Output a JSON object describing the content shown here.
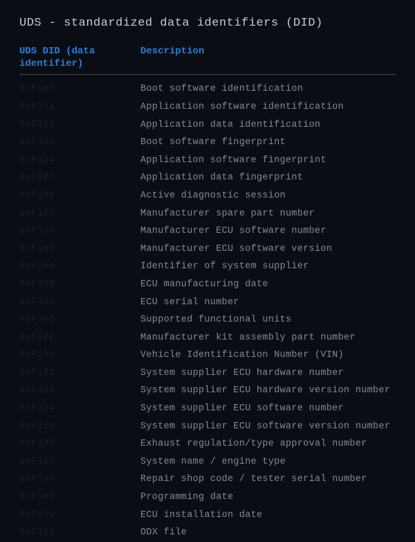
{
  "title": "UDS - standardized data identifiers (DID)",
  "table": {
    "headers": {
      "did": "UDS DID (data identifier)",
      "description": "Description"
    },
    "rows": [
      {
        "did": "0xF180",
        "description": "Boot software identification"
      },
      {
        "did": "0xF181",
        "description": "Application software identification"
      },
      {
        "did": "0xF182",
        "description": "Application data identification"
      },
      {
        "did": "0xF183",
        "description": "Boot software fingerprint"
      },
      {
        "did": "0xF184",
        "description": "Application software fingerprint"
      },
      {
        "did": "0xF185",
        "description": "Application data fingerprint"
      },
      {
        "did": "0xF186",
        "description": "Active diagnostic session"
      },
      {
        "did": "0xF187",
        "description": "Manufacturer spare part number"
      },
      {
        "did": "0xF188",
        "description": "Manufacturer ECU software number"
      },
      {
        "did": "0xF189",
        "description": "Manufacturer ECU software version"
      },
      {
        "did": "0xF18A",
        "description": "Identifier of system supplier"
      },
      {
        "did": "0xF18B",
        "description": "ECU manufacturing date"
      },
      {
        "did": "0xF18C",
        "description": "ECU serial number"
      },
      {
        "did": "0xF18D",
        "description": "Supported functional units"
      },
      {
        "did": "0xF18E",
        "description": "Manufacturer kit assembly part number"
      },
      {
        "did": "0xF190",
        "description": "Vehicle Identification Number (VIN)"
      },
      {
        "did": "0xF192",
        "description": "System supplier ECU hardware number"
      },
      {
        "did": "0xF193",
        "description": "System supplier ECU hardware version number"
      },
      {
        "did": "0xF194",
        "description": "System supplier ECU software number"
      },
      {
        "did": "0xF195",
        "description": "System supplier ECU software version number"
      },
      {
        "did": "0xF196",
        "description": "Exhaust regulation/type approval number"
      },
      {
        "did": "0xF197",
        "description": "System name / engine type"
      },
      {
        "did": "0xF198",
        "description": "Repair shop code / tester serial number"
      },
      {
        "did": "0xF199",
        "description": "Programming date"
      },
      {
        "did": "0xF19D",
        "description": "ECU installation date"
      },
      {
        "did": "0xF19E",
        "description": "ODX file"
      }
    ]
  }
}
